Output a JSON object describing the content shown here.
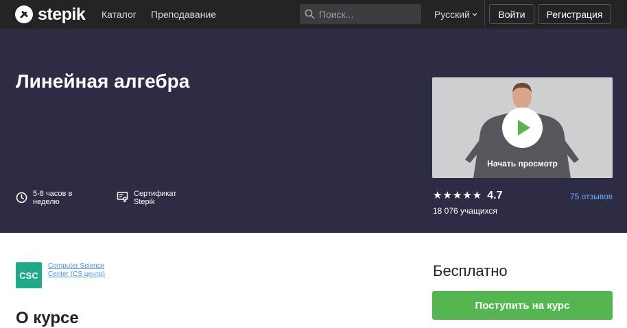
{
  "navbar": {
    "logo_text": "stepik",
    "links": [
      "Каталог",
      "Преподавание"
    ],
    "search_placeholder": "Поиск...",
    "language": "Русский",
    "login_label": "Войти",
    "register_label": "Регистрация"
  },
  "hero": {
    "title": "Линейная алгебра",
    "features": [
      {
        "icon": "clock-icon",
        "text": "5-8 часов в неделю"
      },
      {
        "icon": "certificate-icon",
        "text": "Сертификат Stepik"
      }
    ],
    "video_label": "Начать просмотр",
    "rating_stars": "★★★★★",
    "rating": "4.7",
    "reviews": "75 отзывов",
    "learners": "18 076 учащихся"
  },
  "author": {
    "logo_text": "CSC",
    "name": "Computer Science Center (CS центр)"
  },
  "about_title": "О курсе",
  "sidebar": {
    "price": "Бесплатно",
    "enroll_label": "Поступить на курс"
  },
  "colors": {
    "navbar_bg": "#232326",
    "hero_bg": "#2c2c44",
    "accent_green": "#54b551",
    "link_blue": "#6aa8f7",
    "author_logo_bg": "#1fa98c"
  }
}
